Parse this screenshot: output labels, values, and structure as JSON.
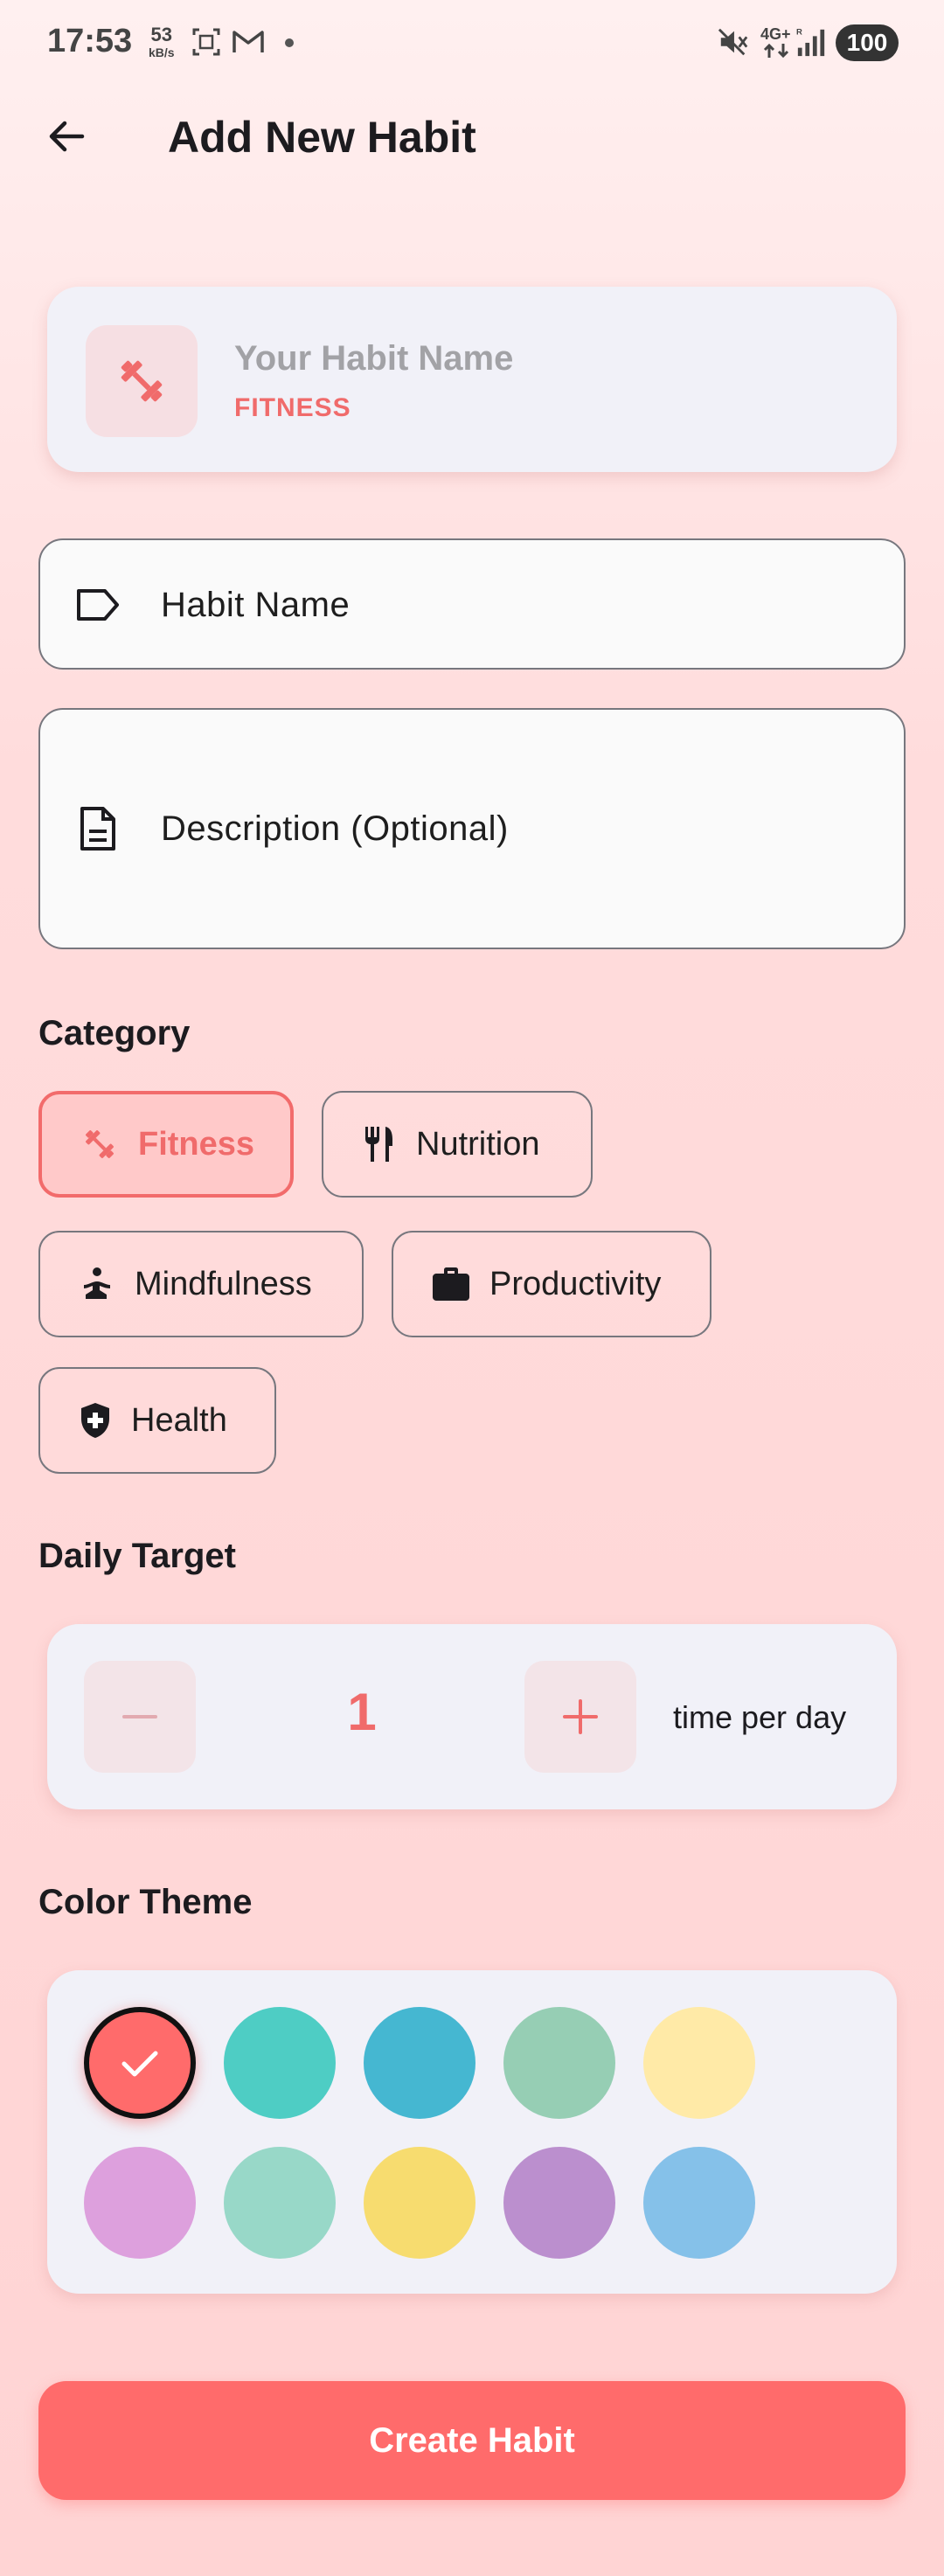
{
  "status_bar": {
    "time": "17:53",
    "speed_value": "53",
    "speed_unit": "kB/s",
    "network_label": "4G+",
    "battery": "100"
  },
  "header": {
    "title": "Add New Habit"
  },
  "preview": {
    "name_placeholder": "Your Habit Name",
    "category": "FITNESS"
  },
  "form": {
    "habit_name_label": "Habit Name",
    "description_label": "Description (Optional)"
  },
  "category": {
    "label": "Category",
    "selected": "Fitness",
    "chips": [
      {
        "label": "Fitness",
        "icon": "dumbbell-icon"
      },
      {
        "label": "Nutrition",
        "icon": "utensils-icon"
      },
      {
        "label": "Mindfulness",
        "icon": "meditation-icon"
      },
      {
        "label": "Productivity",
        "icon": "briefcase-icon"
      },
      {
        "label": "Health",
        "icon": "health-shield-icon"
      }
    ]
  },
  "daily_target": {
    "label": "Daily Target",
    "value": "1",
    "unit": "time per day"
  },
  "color_theme": {
    "label": "Color Theme",
    "selected_index": 0,
    "colors": [
      "#ff6b6b",
      "#4ecdc4",
      "#45b7d1",
      "#96ceb4",
      "#ffeaa7",
      "#dda0dd",
      "#98d8c8",
      "#f7dc6f",
      "#bb8fce",
      "#85c1e9"
    ]
  },
  "actions": {
    "create_label": "Create Habit"
  },
  "colors": {
    "accent": "#ff6b6b",
    "card_bg": "#f1f1f8"
  }
}
